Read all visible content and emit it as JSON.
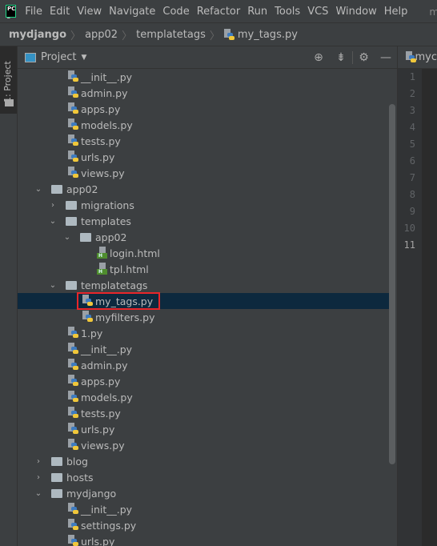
{
  "menubar": {
    "logo": "PC",
    "items": [
      "File",
      "Edit",
      "View",
      "Navigate",
      "Code",
      "Refactor",
      "Run",
      "Tools",
      "VCS",
      "Window",
      "Help"
    ],
    "overflow": "m"
  },
  "breadcrumb": [
    "mydjango",
    "app02",
    "templatetags",
    "my_tags.py"
  ],
  "stripe": {
    "label": "1: Project"
  },
  "tool_window": {
    "title": "Project",
    "tools": [
      "locate-icon",
      "collapse-all-icon",
      "gear-icon",
      "minimize-icon"
    ]
  },
  "tree": [
    {
      "label": "__init__.py",
      "depth": 1,
      "type": "py"
    },
    {
      "label": "admin.py",
      "depth": 1,
      "type": "py"
    },
    {
      "label": "apps.py",
      "depth": 1,
      "type": "py"
    },
    {
      "label": "models.py",
      "depth": 1,
      "type": "py"
    },
    {
      "label": "tests.py",
      "depth": 1,
      "type": "py"
    },
    {
      "label": "urls.py",
      "depth": 1,
      "type": "py"
    },
    {
      "label": "views.py",
      "depth": 1,
      "type": "py"
    },
    {
      "label": "app02",
      "depth": 0,
      "type": "folder",
      "open": true
    },
    {
      "label": "migrations",
      "depth": 1,
      "type": "folder",
      "open": false
    },
    {
      "label": "templates",
      "depth": 1,
      "type": "folder",
      "open": true
    },
    {
      "label": "app02",
      "depth": 2,
      "type": "folder",
      "open": true
    },
    {
      "label": "login.html",
      "depth": 3,
      "type": "html"
    },
    {
      "label": "tpl.html",
      "depth": 3,
      "type": "html"
    },
    {
      "label": "templatetags",
      "depth": 1,
      "type": "folder",
      "open": true
    },
    {
      "label": "my_tags.py",
      "depth": 2,
      "type": "py",
      "selected": true,
      "highlighted": true
    },
    {
      "label": "myfilters.py",
      "depth": 2,
      "type": "py"
    },
    {
      "label": "1.py",
      "depth": 1,
      "type": "py"
    },
    {
      "label": "__init__.py",
      "depth": 1,
      "type": "py"
    },
    {
      "label": "admin.py",
      "depth": 1,
      "type": "py"
    },
    {
      "label": "apps.py",
      "depth": 1,
      "type": "py"
    },
    {
      "label": "models.py",
      "depth": 1,
      "type": "py"
    },
    {
      "label": "tests.py",
      "depth": 1,
      "type": "py"
    },
    {
      "label": "urls.py",
      "depth": 1,
      "type": "py"
    },
    {
      "label": "views.py",
      "depth": 1,
      "type": "py"
    },
    {
      "label": "blog",
      "depth": 0,
      "type": "folder",
      "open": false
    },
    {
      "label": "hosts",
      "depth": 0,
      "type": "folder",
      "open": false
    },
    {
      "label": "mydjango",
      "depth": 0,
      "type": "folder",
      "open": true
    },
    {
      "label": "__init__.py",
      "depth": 1,
      "type": "py"
    },
    {
      "label": "settings.py",
      "depth": 1,
      "type": "py"
    },
    {
      "label": "urls.py",
      "depth": 1,
      "type": "py"
    }
  ],
  "editor": {
    "tab": "myc",
    "line_numbers": [
      "1",
      "2",
      "3",
      "4",
      "5",
      "6",
      "7",
      "8",
      "9",
      "10",
      "11"
    ],
    "current_line": "11"
  },
  "colors": {
    "selection": "#0d293e",
    "highlight_box": "#e8262a",
    "background": "#3c3f41",
    "editor": "#2b2b2b"
  }
}
